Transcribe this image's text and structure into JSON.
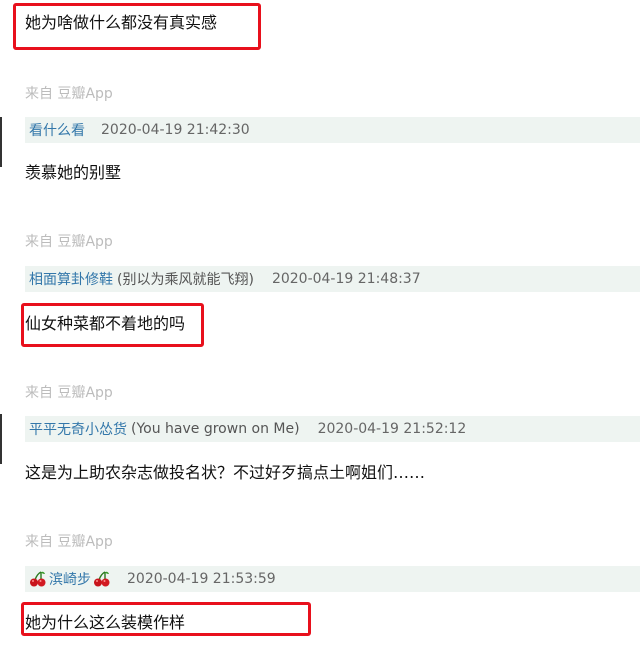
{
  "comments": [
    {
      "text": "她为啥做什么都没有真实感",
      "source": "来自 豆瓣App",
      "user": "看什么看",
      "time": "2020-04-19 21:42:30"
    },
    {
      "text": "羡慕她的别墅",
      "source": "来自 豆瓣App",
      "user": "相面算卦修鞋",
      "signature": "(别以为乘风就能飞翔)",
      "time": "2020-04-19 21:48:37"
    },
    {
      "text": "仙女种菜都不着地的吗",
      "source": "来自 豆瓣App",
      "user": "平平无奇小怂货",
      "signature": "(You have grown on Me)",
      "time": "2020-04-19 21:52:12"
    },
    {
      "text": "这是为上助农杂志做投名状？不过好歹搞点土啊姐们……",
      "source": "来自 豆瓣App",
      "user": "滨崎步",
      "user_icon": "cherry-icon",
      "time": "2020-04-19 21:53:59"
    },
    {
      "text": "她为什么这么装模作样"
    }
  ],
  "colors": {
    "highlight": "#e8101c",
    "link": "#3377aa",
    "meta_bg": "#eef4f1",
    "source_gray": "#bcbcbc"
  }
}
